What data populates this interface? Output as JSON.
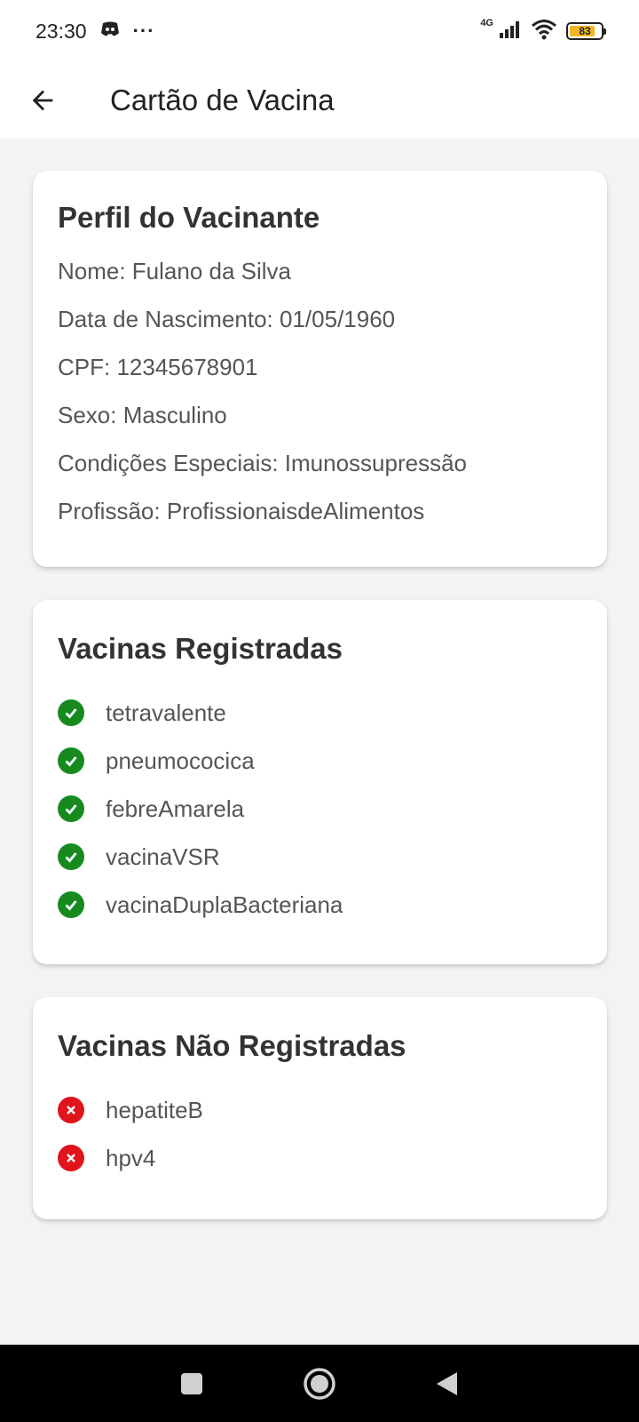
{
  "status_bar": {
    "time": "23:30",
    "more": "···",
    "network": "4G",
    "battery": "83",
    "battery_level": 0.83
  },
  "app_bar": {
    "title": "Cartão de Vacina"
  },
  "profile": {
    "title": "Perfil do Vacinante",
    "lines": [
      "Nome: Fulano da Silva",
      "Data de Nascimento: 01/05/1960",
      "CPF: 12345678901",
      "Sexo: Masculino",
      "Condições Especiais: Imunossupressão",
      "Profissão: ProfissionaisdeAlimentos"
    ]
  },
  "registered": {
    "title": "Vacinas Registradas",
    "items": [
      "tetravalente",
      "pneumococica",
      "febreAmarela",
      "vacinaVSR",
      "vacinaDuplaBacteriana"
    ]
  },
  "unregistered": {
    "title": "Vacinas Não Registradas",
    "items": [
      "hepatiteB",
      "hpv4"
    ]
  },
  "colors": {
    "ok": "#178a1e",
    "missing": "#e0141c",
    "battery_fill": "#f2b824"
  },
  "icons": {
    "back": "arrow-left-icon",
    "ok": "check-circle-icon",
    "missing": "x-circle-icon",
    "nav_recent": "square-icon",
    "nav_home": "circle-icon",
    "nav_back": "triangle-icon"
  }
}
